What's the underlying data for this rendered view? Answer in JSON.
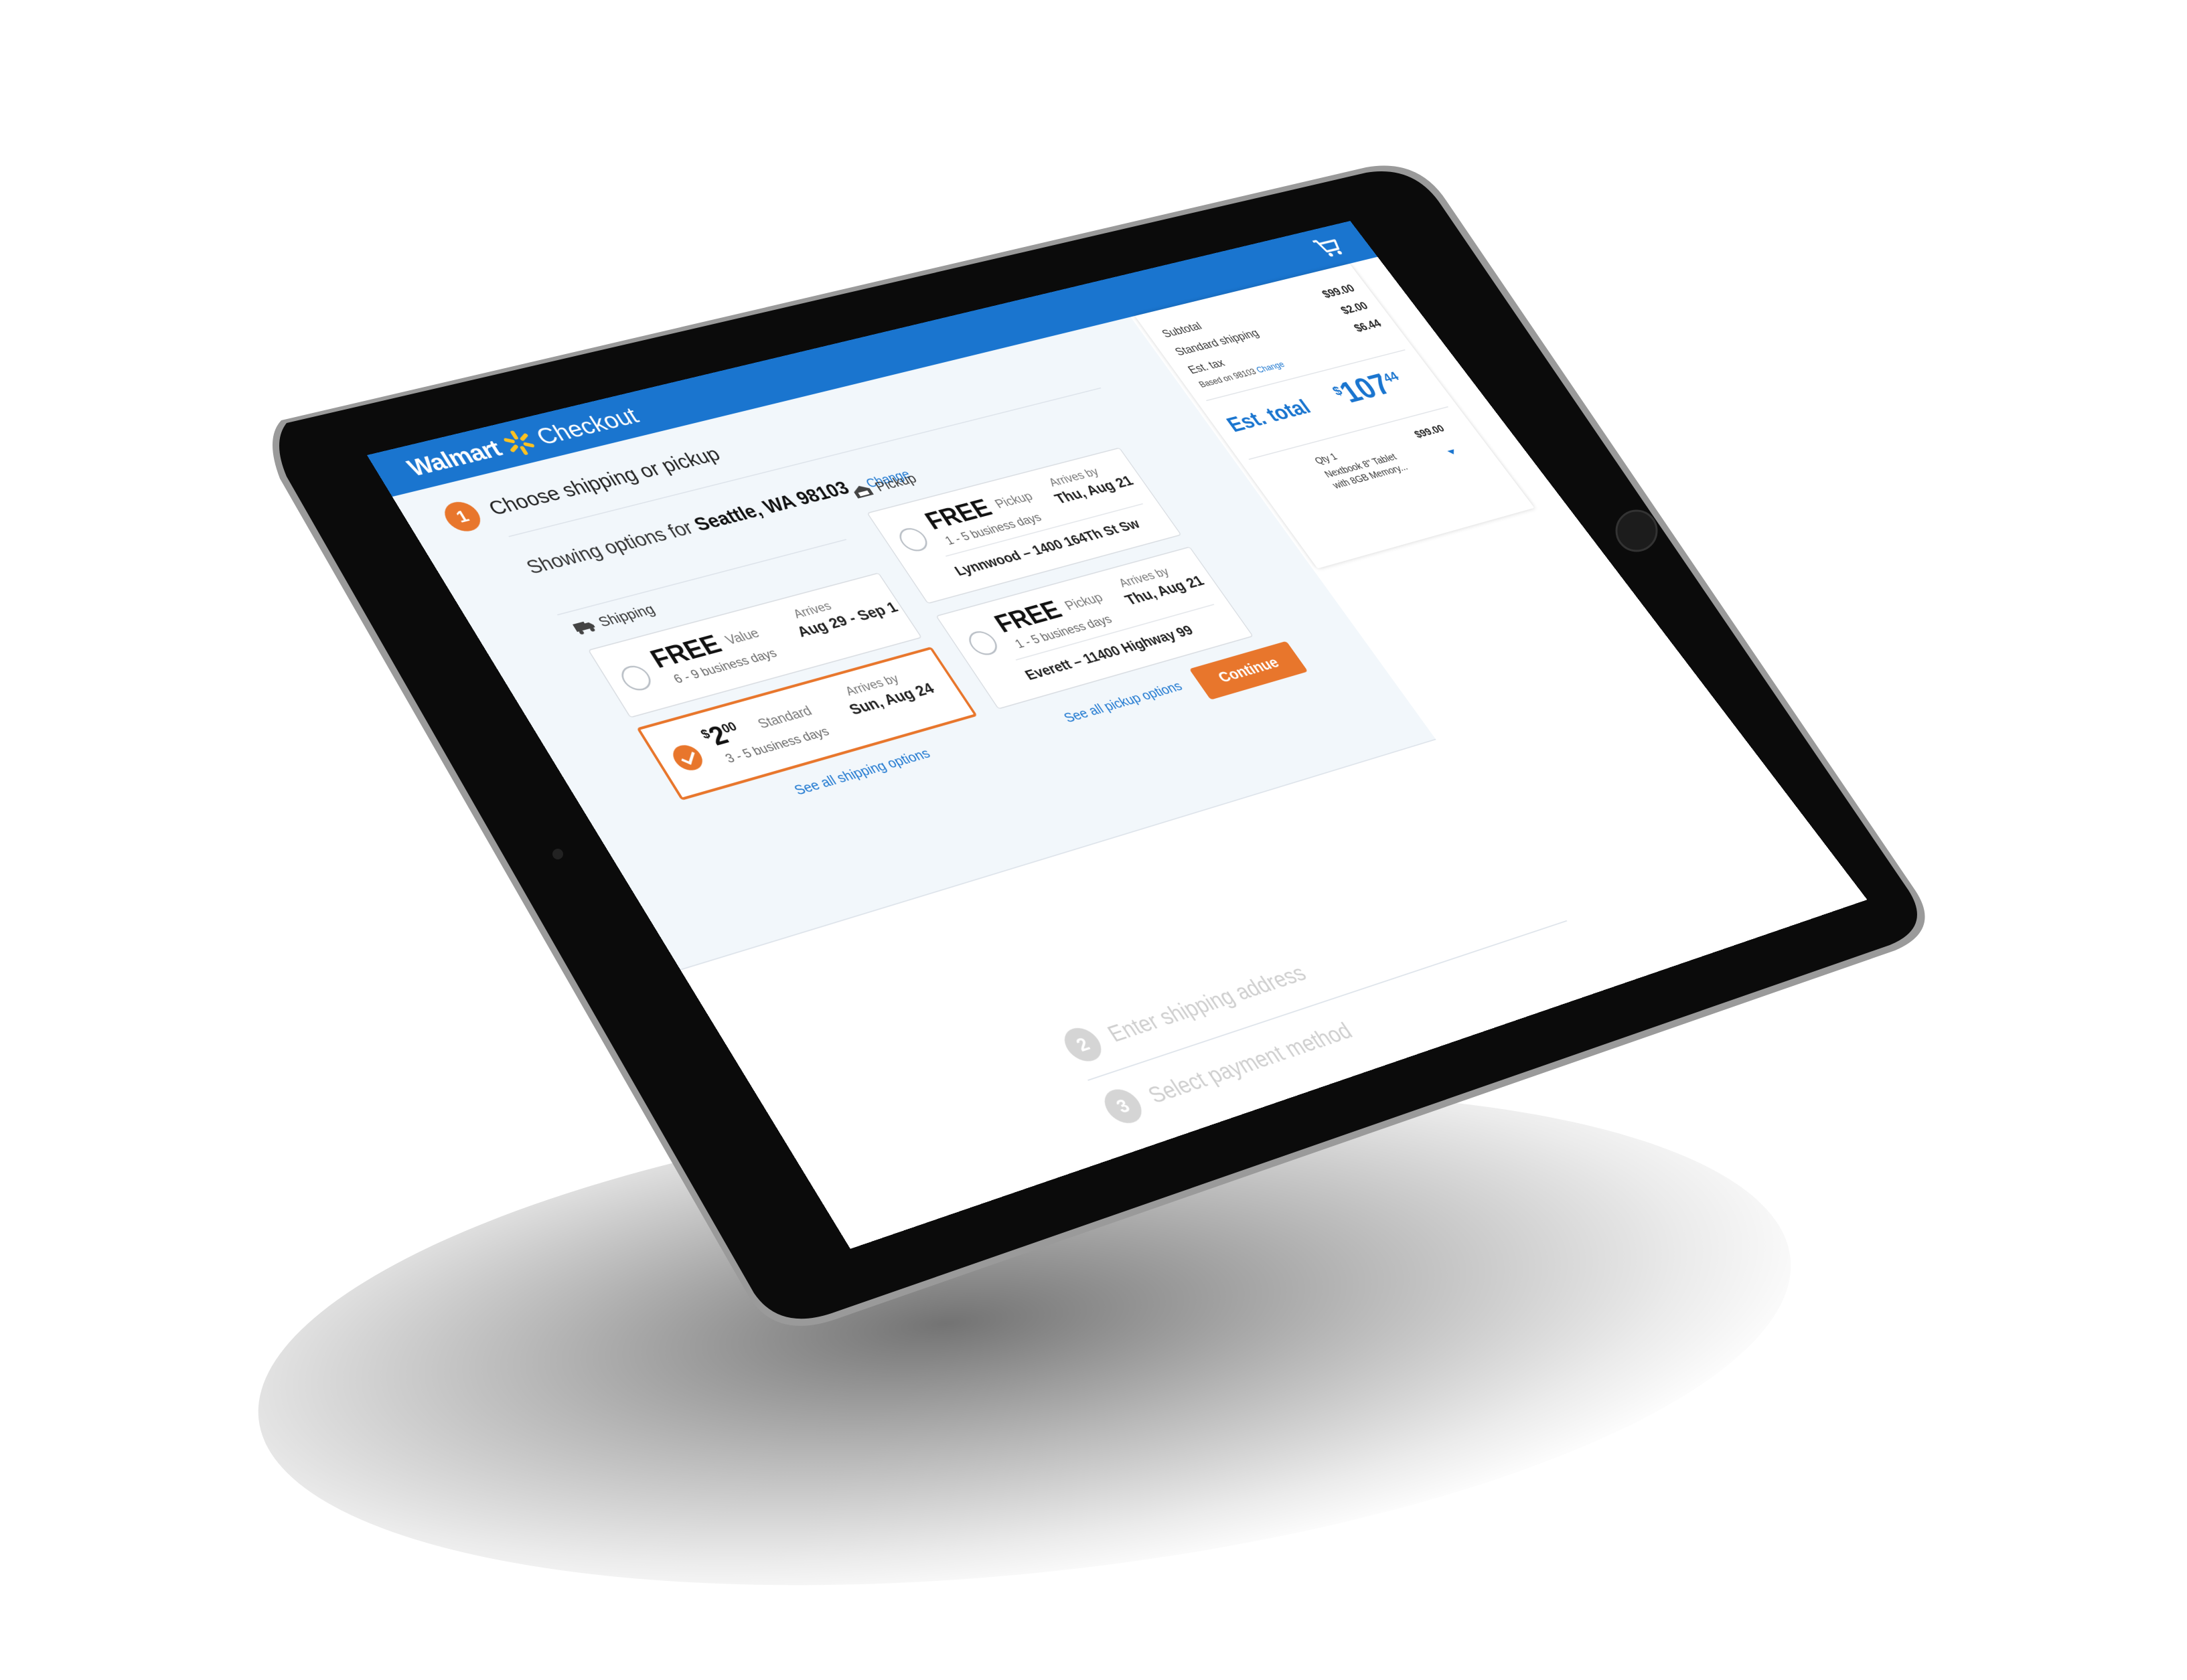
{
  "header": {
    "brand": "Walmart",
    "section": "Checkout"
  },
  "steps": [
    {
      "number": "1",
      "title": "Choose shipping or pickup",
      "change_link": "Change"
    },
    {
      "number": "2",
      "title": "Enter shipping address"
    },
    {
      "number": "3",
      "title": "Select payment method"
    }
  ],
  "location": {
    "prefix": "Showing options for ",
    "place": "Seattle, WA 98103"
  },
  "shipping": {
    "label": "Shipping",
    "options": [
      {
        "price": "FREE",
        "tier": "Value",
        "days": "6 - 9 business days",
        "arrives_label": "Arrives",
        "arrives_date": "Aug 29 - Sep 1",
        "selected": false
      },
      {
        "price_symbol": "$",
        "price_int": "2",
        "price_dec": "00",
        "tier": "Standard",
        "days": "3 - 5 business days",
        "arrives_label": "Arrives by",
        "arrives_date": "Sun, Aug 24",
        "selected": true
      }
    ],
    "see_all": "See all shipping options"
  },
  "pickup": {
    "label": "Pickup",
    "options": [
      {
        "price": "FREE",
        "tier": "Pickup",
        "days": "1 - 5 business days",
        "arrives_label": "Arrives by",
        "arrives_date": "Thu, Aug 21",
        "store": "Lynnwood – 1400 164Th St Sw"
      },
      {
        "price": "FREE",
        "tier": "Pickup",
        "days": "1 - 5 business days",
        "arrives_label": "Arrives by",
        "arrives_date": "Thu, Aug 21",
        "store": "Everett – 11400 Highway 99"
      }
    ],
    "see_all": "See all pickup options"
  },
  "continue_label": "Continue",
  "summary": {
    "subtotal_label": "Subtotal",
    "subtotal": "$99.00",
    "shipping_label": "Standard shipping",
    "shipping": "$2.00",
    "tax_label": "Est. tax",
    "tax": "$6.44",
    "tax_note": "Based on 98103",
    "tax_change": "Change",
    "est_total_label": "Est. total",
    "est_total_symbol": "$",
    "est_total_int": "107",
    "est_total_dec": "44",
    "item": {
      "qty": "Qty 1",
      "price": "$99.00",
      "name": "Nextbook 8\" Tablet with 8GB Memory..."
    }
  },
  "colors": {
    "brand_blue": "#1a75cf",
    "accent_orange": "#e8762c",
    "spark_yellow": "#ffc220"
  },
  "icons": [
    "cart-icon",
    "spark-logo-icon",
    "truck-icon",
    "store-icon",
    "check-icon",
    "caret-down-icon"
  ]
}
